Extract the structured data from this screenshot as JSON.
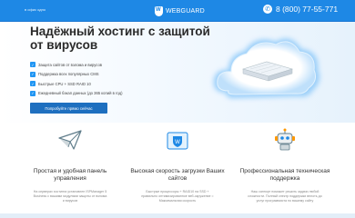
{
  "header": {
    "link_text": "в офис одно",
    "logo_text": "WEBGUARD",
    "phone": "8 (800) 77-55-771"
  },
  "hero": {
    "title": "Надёжный хостинг с защитой от вирусов",
    "features": [
      "Защита сайтов от взлома и вирусов",
      "Поддержка всех популярных CMS",
      "Быстрые CPU + SSD RAID 10",
      "Ежедневный бэкап данных (до 365 копий в год)"
    ],
    "cta_label": "Попробуйте прямо сейчас"
  },
  "benefits": [
    {
      "title": "Простая и удобная панель управления",
      "text": "На серверах хостинга установлен ISPManager 5 Business с вашими модулями защиты от взлома и вирусов"
    },
    {
      "title": "Высокая скорость загрузки Ваших сайтов",
      "text": "Быстрые процессоры + RAID10 на SSD + правильно оптимизированное веб-окружение = Максимальная скорость"
    },
    {
      "title": "Профессиональная техническая поддержка",
      "text": "Наш саппорт поможет решить задачи любой сложности. Полный спектр поддержки вплоть до услуг программиста по вашему сайту"
    }
  ],
  "colors": {
    "brand": "#1e88e5",
    "cta": "#1e6fbf",
    "cloud_glow": "#90caf9"
  }
}
